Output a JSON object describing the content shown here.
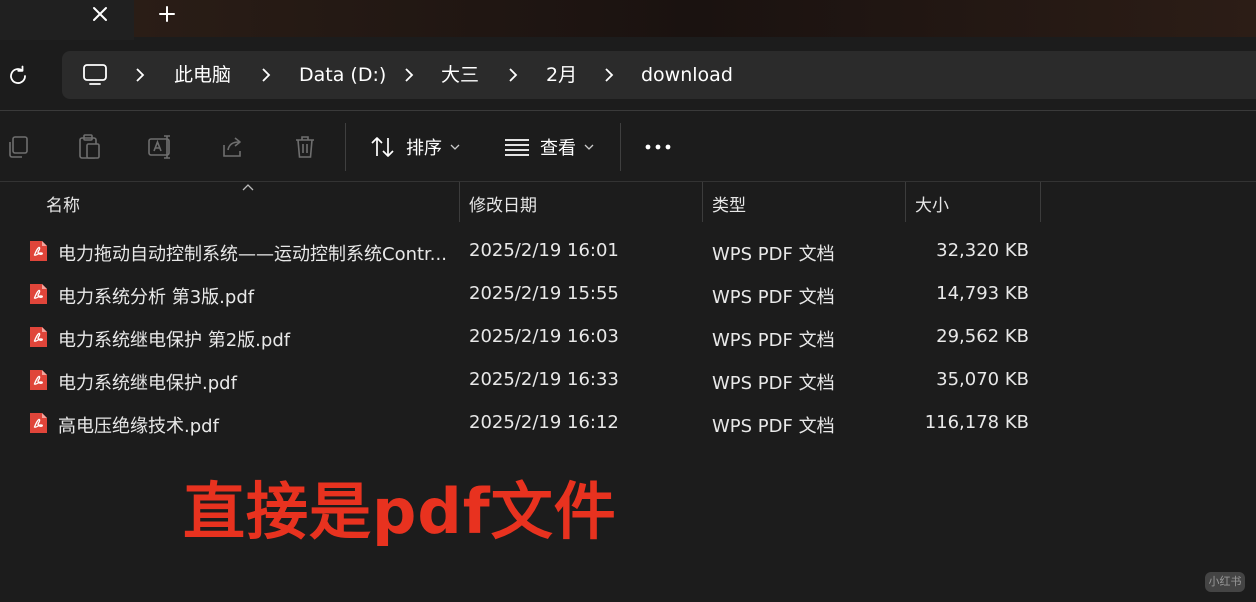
{
  "tabs": {
    "close_icon": "close-icon",
    "new_tab_icon": "plus-icon"
  },
  "address": {
    "refresh_icon": "refresh-icon",
    "root_icon": "computer-icon",
    "crumbs": [
      "此电脑",
      "Data (D:)",
      "大三",
      "2月",
      "download"
    ]
  },
  "toolbar": {
    "sort_label": "排序",
    "view_label": "查看",
    "icons": [
      "copy-icon",
      "paste-icon",
      "rename-icon",
      "share-icon",
      "delete-icon"
    ]
  },
  "columns": {
    "name": "名称",
    "modified": "修改日期",
    "type": "类型",
    "size": "大小"
  },
  "files": [
    {
      "name": "电力拖动自动控制系统——运动控制系统Contr...",
      "modified": "2025/2/19 16:01",
      "type": "WPS PDF 文档",
      "size": "32,320 KB"
    },
    {
      "name": "电力系统分析 第3版.pdf",
      "modified": "2025/2/19 15:55",
      "type": "WPS PDF 文档",
      "size": "14,793 KB"
    },
    {
      "name": "电力系统继电保护 第2版.pdf",
      "modified": "2025/2/19 16:03",
      "type": "WPS PDF 文档",
      "size": "29,562 KB"
    },
    {
      "name": "电力系统继电保护.pdf",
      "modified": "2025/2/19 16:33",
      "type": "WPS PDF 文档",
      "size": "35,070 KB"
    },
    {
      "name": "高电压绝缘技术.pdf",
      "modified": "2025/2/19 16:12",
      "type": "WPS PDF 文档",
      "size": "116,178 KB"
    }
  ],
  "annotation": "直接是pdf文件",
  "watermark": "小红书",
  "colors": {
    "background": "#1c1c1c",
    "address_bar": "#2b2b2b",
    "pdf_icon": "#e0453a",
    "annotation": "#e8321f"
  }
}
